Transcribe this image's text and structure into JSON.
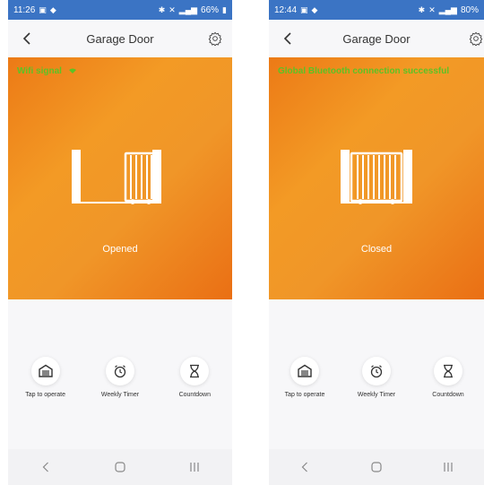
{
  "screens": [
    {
      "status_bar": {
        "time": "11:26",
        "right": "66%"
      },
      "title": "Garage Door",
      "connection_text": "Wifi signal",
      "door_state": "Opened",
      "controls": [
        {
          "label": "Tap to operate",
          "icon": "garage-icon"
        },
        {
          "label": "Weekly Timer",
          "icon": "alarm-clock-icon"
        },
        {
          "label": "Countdown",
          "icon": "hourglass-icon"
        }
      ]
    },
    {
      "status_bar": {
        "time": "12:44",
        "right": "80%"
      },
      "title": "Garage Door",
      "connection_text": "Global Bluetooth connection successful",
      "door_state": "Closed",
      "controls": [
        {
          "label": "Tap to operate",
          "icon": "garage-icon"
        },
        {
          "label": "Weekly Timer",
          "icon": "alarm-clock-icon"
        },
        {
          "label": "Countdown",
          "icon": "hourglass-icon"
        }
      ]
    }
  ],
  "colors": {
    "status_bar": "#3b74c4",
    "hero_orange": "#f09628",
    "connection_green": "#5dc225"
  }
}
